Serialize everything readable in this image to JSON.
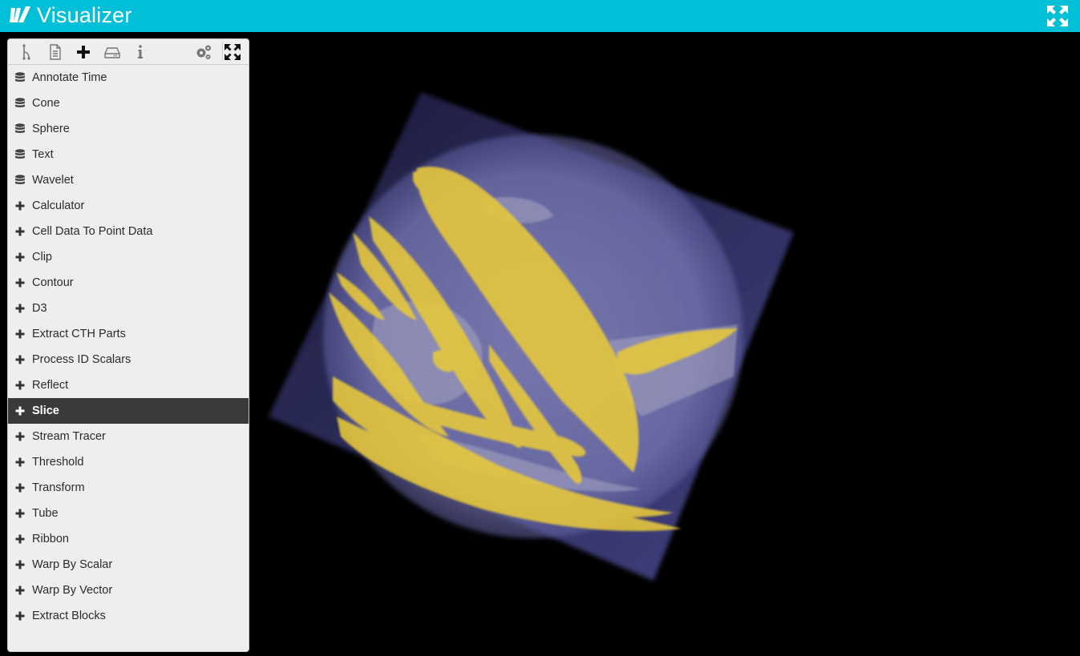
{
  "header": {
    "title": "Visualizer",
    "logo_icon": "visualizer-logo-icon",
    "fullscreen_icon": "expand-arrows-icon"
  },
  "toolbar": {
    "buttons": [
      {
        "icon": "pipeline-tree-icon"
      },
      {
        "icon": "document-icon"
      },
      {
        "icon": "plus-icon"
      },
      {
        "icon": "hard-drive-icon"
      },
      {
        "icon": "info-icon"
      },
      {
        "icon": "gears-icon"
      },
      {
        "icon": "collapse-arrows-icon"
      }
    ]
  },
  "filters": {
    "sources": [
      {
        "label": "Annotate Time",
        "icon": "database-icon"
      },
      {
        "label": "Cone",
        "icon": "database-icon"
      },
      {
        "label": "Sphere",
        "icon": "database-icon"
      },
      {
        "label": "Text",
        "icon": "database-icon"
      },
      {
        "label": "Wavelet",
        "icon": "database-icon"
      }
    ],
    "items": [
      {
        "label": "Calculator",
        "icon": "plus-icon"
      },
      {
        "label": "Cell Data To Point Data",
        "icon": "plus-icon"
      },
      {
        "label": "Clip",
        "icon": "plus-icon"
      },
      {
        "label": "Contour",
        "icon": "plus-icon"
      },
      {
        "label": "D3",
        "icon": "plus-icon"
      },
      {
        "label": "Extract CTH Parts",
        "icon": "plus-icon"
      },
      {
        "label": "Process ID Scalars",
        "icon": "plus-icon"
      },
      {
        "label": "Reflect",
        "icon": "plus-icon"
      },
      {
        "label": "Slice",
        "icon": "plus-icon",
        "selected": true
      },
      {
        "label": "Stream Tracer",
        "icon": "plus-icon"
      },
      {
        "label": "Threshold",
        "icon": "plus-icon"
      },
      {
        "label": "Transform",
        "icon": "plus-icon"
      },
      {
        "label": "Tube",
        "icon": "plus-icon"
      },
      {
        "label": "Ribbon",
        "icon": "plus-icon"
      },
      {
        "label": "Warp By Scalar",
        "icon": "plus-icon"
      },
      {
        "label": "Warp By Vector",
        "icon": "plus-icon"
      },
      {
        "label": "Extract Blocks",
        "icon": "plus-icon"
      }
    ]
  },
  "colors": {
    "header": "#00bfd6",
    "volume_purple": "#6a6aa8",
    "volume_yellow": "#f2d23a",
    "selected_row": "#3a3a3a"
  }
}
